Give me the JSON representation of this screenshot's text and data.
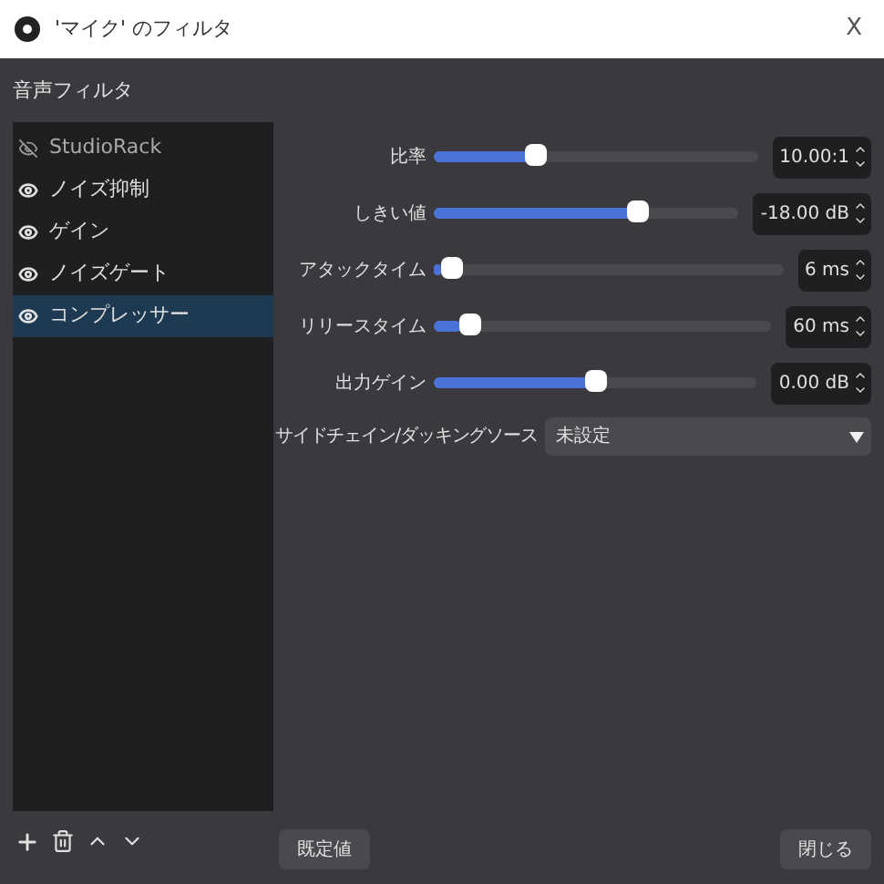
{
  "window": {
    "title": "'マイク' のフィルタ",
    "close": "X"
  },
  "section_label": "音声フィルタ",
  "filters": [
    {
      "name": "StudioRack",
      "enabled": false,
      "selected": false
    },
    {
      "name": "ノイズ抑制",
      "enabled": true,
      "selected": false
    },
    {
      "name": "ゲイン",
      "enabled": true,
      "selected": false
    },
    {
      "name": "ノイズゲート",
      "enabled": true,
      "selected": false
    },
    {
      "name": "コンプレッサー",
      "enabled": true,
      "selected": true
    }
  ],
  "settings": [
    {
      "label": "比率",
      "level": 0.3,
      "value": "10.00:1"
    },
    {
      "label": "しきい値",
      "level": 0.68,
      "value": "-18.00 dB"
    },
    {
      "label": "アタックタイム",
      "level": 0.02,
      "value": "6 ms"
    },
    {
      "label": "リリースタイム",
      "level": 0.08,
      "value": "60 ms"
    },
    {
      "label": "出力ゲイン",
      "level": 0.5,
      "value": "0.00 dB"
    }
  ],
  "sidechain": {
    "label": "サイドチェイン/ダッキングソース",
    "value": "未設定"
  },
  "buttons": {
    "defaults": "既定値",
    "close": "閉じる"
  }
}
